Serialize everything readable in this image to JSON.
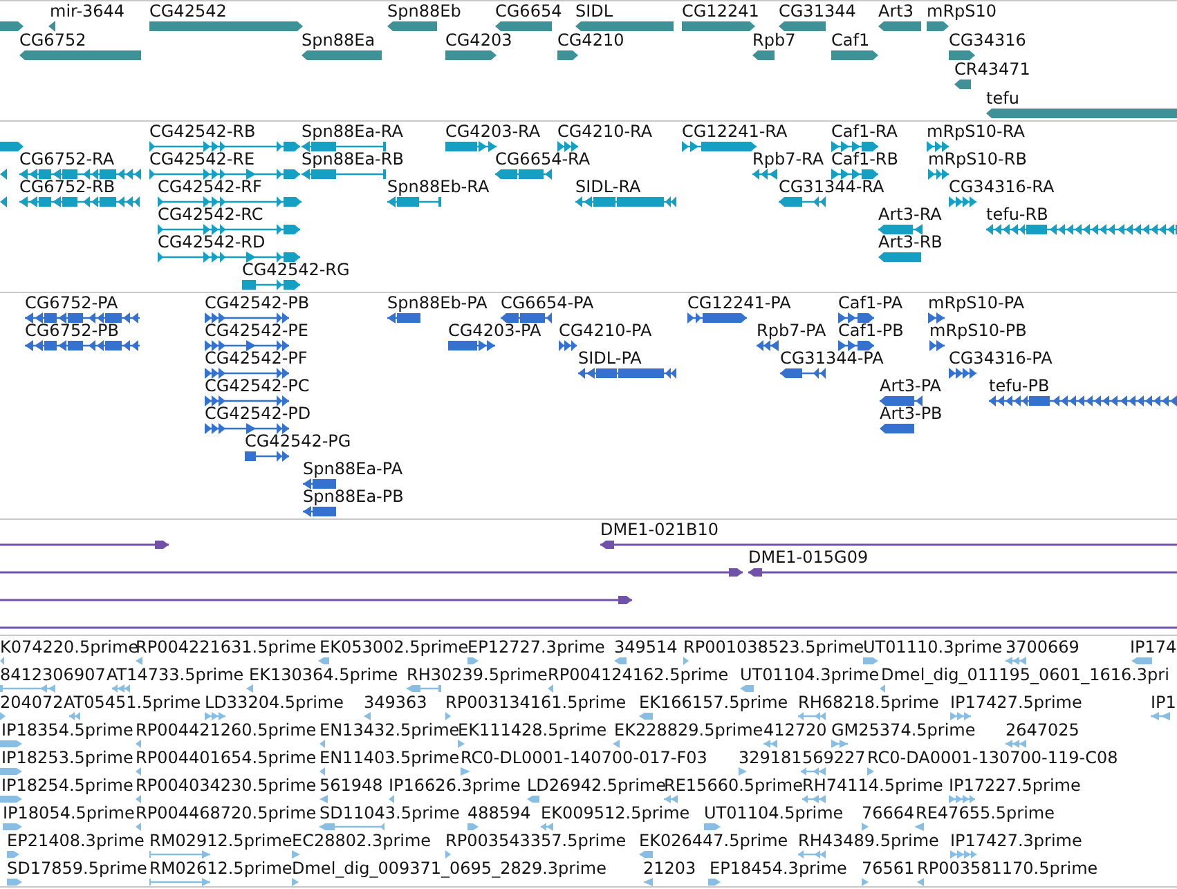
{
  "tracks": [
    {
      "kind": "gene",
      "features": [
        {
          "forward": true
        },
        {
          "label": "mir-3644",
          "forward": false
        },
        {
          "label": "CG42542",
          "forward": true
        },
        {
          "label": "Spn88Eb",
          "forward": false
        },
        {
          "label": "CG6654",
          "forward": false
        },
        {
          "label": "SIDL",
          "forward": false
        },
        {
          "label": "CG12241",
          "forward": true
        },
        {
          "label": "CG31344",
          "forward": false
        },
        {
          "label": "Art3",
          "forward": false
        },
        {
          "label": "mRpS10",
          "forward": true
        },
        {
          "label": "CG6752",
          "forward": false
        },
        {
          "label": "Spn88Ea",
          "forward": false
        },
        {
          "label": "CG4203",
          "forward": true
        },
        {
          "label": "CG4210",
          "forward": true
        },
        {
          "label": "Rpb7",
          "forward": false
        },
        {
          "label": "Caf1",
          "forward": true
        },
        {
          "label": "CG34316",
          "forward": true
        },
        {
          "label": "CR43471",
          "forward": false
        },
        {
          "label": "tefu",
          "forward": false
        }
      ]
    },
    {
      "kind": "transcript",
      "features": [
        {
          "forward": true
        },
        {
          "label": "CG42542-RB",
          "forward": true
        },
        {
          "label": "Spn88Ea-RA",
          "forward": false
        },
        {
          "label": "CG4203-RA",
          "forward": true
        },
        {
          "label": "CG4210-RA",
          "forward": true
        },
        {
          "label": "CG12241-RA",
          "forward": true
        },
        {
          "label": "Caf1-RA",
          "forward": true
        },
        {
          "label": "mRpS10-RA",
          "forward": true
        },
        {
          "forward": false
        },
        {
          "label": "CG6752-RA",
          "forward": false
        },
        {
          "label": "CG42542-RE",
          "forward": true
        },
        {
          "label": "Spn88Ea-RB",
          "forward": false
        },
        {
          "label": "CG6654-RA",
          "forward": false
        },
        {
          "label": "Rpb7-RA",
          "forward": false
        },
        {
          "label": "Caf1-RB",
          "forward": true
        },
        {
          "label": "mRpS10-RB",
          "forward": true
        },
        {
          "forward": false
        },
        {
          "label": "CG6752-RB",
          "forward": false
        },
        {
          "label": "CG42542-RF",
          "forward": true
        },
        {
          "label": "Spn88Eb-RA",
          "forward": false
        },
        {
          "label": "SIDL-RA",
          "forward": false
        },
        {
          "label": "CG31344-RA",
          "forward": false
        },
        {
          "label": "CG34316-RA",
          "forward": true
        },
        {
          "label": "CG42542-RC",
          "forward": true
        },
        {
          "label": "Art3-RA",
          "forward": false
        },
        {
          "label": "tefu-RB",
          "forward": false
        },
        {
          "label": "CG42542-RD",
          "forward": true
        },
        {
          "label": "Art3-RB",
          "forward": false
        },
        {
          "label": "CG42542-RG",
          "forward": true
        }
      ]
    },
    {
      "kind": "protein",
      "features": [
        {
          "label": "CG6752-PA",
          "forward": false
        },
        {
          "label": "CG42542-PB",
          "forward": true
        },
        {
          "label": "Spn88Eb-PA",
          "forward": false
        },
        {
          "label": "CG6654-PA",
          "forward": false
        },
        {
          "label": "CG12241-PA",
          "forward": true
        },
        {
          "label": "Caf1-PA",
          "forward": true
        },
        {
          "label": "mRpS10-PA",
          "forward": true
        },
        {
          "label": "CG6752-PB",
          "forward": false
        },
        {
          "label": "CG42542-PE",
          "forward": true
        },
        {
          "label": "CG4203-PA",
          "forward": true
        },
        {
          "label": "CG4210-PA",
          "forward": true
        },
        {
          "label": "Rpb7-PA",
          "forward": false
        },
        {
          "label": "Caf1-PB",
          "forward": true
        },
        {
          "label": "mRpS10-PB",
          "forward": true
        },
        {
          "label": "CG42542-PF",
          "forward": true
        },
        {
          "label": "SIDL-PA",
          "forward": false
        },
        {
          "label": "CG31344-PA",
          "forward": false
        },
        {
          "label": "CG34316-PA",
          "forward": true
        },
        {
          "label": "CG42542-PC",
          "forward": true
        },
        {
          "label": "Art3-PA",
          "forward": false
        },
        {
          "label": "tefu-PB",
          "forward": false
        },
        {
          "label": "CG42542-PD",
          "forward": true
        },
        {
          "label": "Art3-PB",
          "forward": false
        },
        {
          "label": "CG42542-PG",
          "forward": true
        },
        {
          "label": "Spn88Ea-PA",
          "forward": false
        },
        {
          "label": "Spn88Ea-PB",
          "forward": false
        }
      ]
    },
    {
      "kind": "clone",
      "features": [
        {
          "forward": true
        },
        {
          "label": "DME1-021B10",
          "forward": false
        },
        {
          "forward": true
        },
        {
          "label": "DME1-015G09",
          "forward": false
        },
        {
          "forward": true
        }
      ]
    },
    {
      "kind": "est",
      "features": [
        {
          "label": "K074220.5prime",
          "forward": false
        },
        {
          "label": "RP004221631.5prime",
          "forward": false
        },
        {
          "label": "EK053002.5prime",
          "forward": false
        },
        {
          "label": "EP12727.3prime",
          "forward": true
        },
        {
          "label": "349514",
          "forward": false
        },
        {
          "label": "RP001038523.5prime",
          "forward": true
        },
        {
          "label": "UT01110.3prime",
          "forward": true
        },
        {
          "label": "3700669",
          "forward": false
        },
        {
          "label": "IP174",
          "forward": false
        },
        {
          "label": "8412306907",
          "forward": false
        },
        {
          "label": "AT14733.5prime",
          "forward": false
        },
        {
          "label": "EK130364.5prime",
          "forward": false
        },
        {
          "label": "RH30239.5prime",
          "forward": false
        },
        {
          "label": "RP004124162.5prime",
          "forward": false
        },
        {
          "label": "UT01104.3prime",
          "forward": false
        },
        {
          "label": "Dmel_dig_011195_0601_1616.3pri",
          "forward": false
        },
        {
          "label": "204072",
          "forward": true
        },
        {
          "label": "AT05451.5prime",
          "forward": false
        },
        {
          "label": "LD33204.5prime",
          "forward": true
        },
        {
          "label": "349363",
          "forward": false
        },
        {
          "label": "RP003134161.5prime",
          "forward": true
        },
        {
          "label": "EK166157.5prime",
          "forward": false
        },
        {
          "label": "RH68218.5prime",
          "forward": false
        },
        {
          "label": "IP17427.5prime",
          "forward": true
        },
        {
          "label": "IP1",
          "forward": false
        },
        {
          "label": "IP18354.5prime",
          "forward": true
        },
        {
          "label": "RP004421260.5prime",
          "forward": false
        },
        {
          "label": "EN13432.5prime",
          "forward": false
        },
        {
          "label": "EK111428.5prime",
          "forward": true
        },
        {
          "label": "EK228829.5prime",
          "forward": false
        },
        {
          "label": "412720",
          "forward": false
        },
        {
          "label": "GM25374.5prime",
          "forward": true
        },
        {
          "label": "2647025",
          "forward": false
        },
        {
          "label": "IP18253.5prime",
          "forward": true
        },
        {
          "label": "RP004401654.5prime",
          "forward": false
        },
        {
          "label": "EN11403.5prime",
          "forward": false
        },
        {
          "label": "RC0-DL0001-140700-017-F03",
          "forward": true
        },
        {
          "label": "329181",
          "forward": true
        },
        {
          "label": "569227",
          "forward": false
        },
        {
          "label": "RC0-DA0001-130700-119-C08",
          "forward": true
        },
        {
          "label": "IP18254.5prime",
          "forward": true
        },
        {
          "label": "RP004034230.5prime",
          "forward": false
        },
        {
          "label": "561948",
          "forward": false
        },
        {
          "label": "IP16626.3prime",
          "forward": false
        },
        {
          "label": "LD26942.5prime",
          "forward": false
        },
        {
          "label": "RE15660.5prime",
          "forward": false
        },
        {
          "label": "RH74114.5prime",
          "forward": false
        },
        {
          "label": "IP17227.5prime",
          "forward": true
        },
        {
          "label": "IP18054.5prime",
          "forward": true
        },
        {
          "label": "RP004468720.5prime",
          "forward": false
        },
        {
          "label": "SD11043.5prime",
          "forward": false
        },
        {
          "label": "488594",
          "forward": true
        },
        {
          "label": "EK009512.5prime",
          "forward": false
        },
        {
          "label": "UT01104.5prime",
          "forward": true
        },
        {
          "label": "76664",
          "forward": true
        },
        {
          "label": "RE47655.5prime",
          "forward": false
        },
        {
          "label": "EP21408.3prime",
          "forward": true
        },
        {
          "label": "RM02912.5prime",
          "forward": true
        },
        {
          "label": "EC28802.3prime",
          "forward": true
        },
        {
          "label": "RP003543357.5prime",
          "forward": true
        },
        {
          "label": "EK026447.5prime",
          "forward": false
        },
        {
          "label": "RH43489.5prime",
          "forward": false
        },
        {
          "label": "IP17427.3prime",
          "forward": true
        },
        {
          "label": "SD17859.5prime",
          "forward": true
        },
        {
          "label": "RM02612.5prime",
          "forward": true
        },
        {
          "label": "Dmel_dig_009371_0695_2829.3prime",
          "forward": true
        },
        {
          "label": "21203",
          "forward": false
        },
        {
          "label": "EP18454.3prime",
          "forward": true
        },
        {
          "label": "76561",
          "forward": true
        },
        {
          "label": "RP003581170.5prime",
          "forward": false
        }
      ]
    }
  ]
}
